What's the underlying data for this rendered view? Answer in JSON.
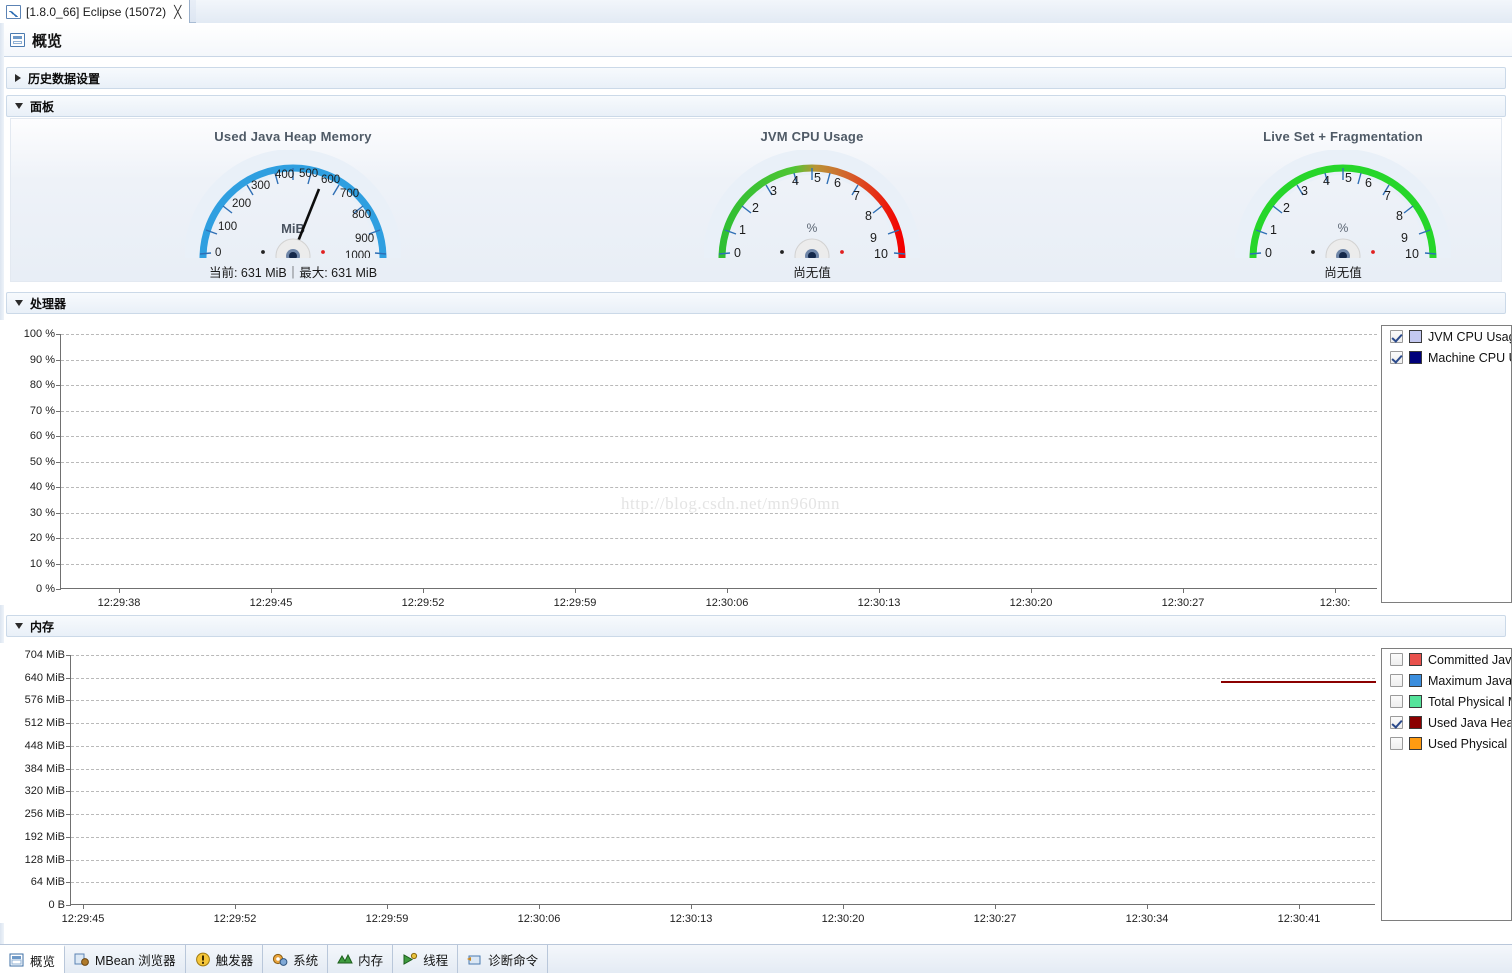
{
  "window": {
    "tab_label": "[1.8.0_66] Eclipse (15072)",
    "tab_icon": "chart-line-icon",
    "close_icon": "╳"
  },
  "page": {
    "title": "概览",
    "icon": "overview-icon"
  },
  "sections": [
    {
      "key": "history",
      "label": "历史数据设置",
      "expanded": false
    },
    {
      "key": "dashboard",
      "label": "面板",
      "expanded": true
    },
    {
      "key": "processor",
      "label": "处理器",
      "expanded": true
    },
    {
      "key": "memory",
      "label": "内存",
      "expanded": true
    }
  ],
  "dashboard": {
    "gauges": [
      {
        "title": "Used Java Heap Memory",
        "unit": "MiB",
        "ticks": [
          "0",
          "100",
          "200",
          "300",
          "400",
          "500",
          "600",
          "700",
          "800",
          "900",
          "1000"
        ],
        "min": 0,
        "max": 1000,
        "value": 631,
        "arc_color": "#2f9fe0",
        "footer": "当前: 631 MiB｜最大: 631 MiB",
        "footer_current_label": "当前",
        "footer_current_value": "631 MiB",
        "footer_max_label": "最大",
        "footer_max_value": "631 MiB"
      },
      {
        "title": "JVM CPU Usage",
        "unit": "%",
        "ticks": [
          "0",
          "1",
          "2",
          "3",
          "4",
          "5",
          "6",
          "7",
          "8",
          "9",
          "10"
        ],
        "min": 0,
        "max": 10,
        "value": null,
        "arc_color": "green-to-red",
        "footer": "尚无值"
      },
      {
        "title": "Live Set + Fragmentation",
        "unit": "%",
        "ticks": [
          "0",
          "1",
          "2",
          "3",
          "4",
          "5",
          "6",
          "7",
          "8",
          "9",
          "10"
        ],
        "min": 0,
        "max": 10,
        "value": null,
        "arc_color": "#26d62a",
        "footer": "尚无值"
      }
    ]
  },
  "chart_data": [
    {
      "id": "processor",
      "type": "line",
      "title": "处理器",
      "xlabel": "",
      "ylabel": "",
      "ylim": [
        0,
        100
      ],
      "yticks": [
        "0 %",
        "10 %",
        "20 %",
        "30 %",
        "40 %",
        "50 %",
        "60 %",
        "70 %",
        "80 %",
        "90 %",
        "100 %"
      ],
      "xticks": [
        "12:29:38",
        "12:29:45",
        "12:29:52",
        "12:29:59",
        "12:30:06",
        "12:30:13",
        "12:30:20",
        "12:30:27",
        "12:30:"
      ],
      "grid": true,
      "legend_position": "right",
      "watermark": "http://blog.csdn.net/mn960mn",
      "series": [
        {
          "name": "JVM CPU Usage",
          "color": "#c3c8f0",
          "checked": true,
          "values": []
        },
        {
          "name": "Machine CPU U",
          "color": "#00007a",
          "checked": true,
          "values": []
        }
      ]
    },
    {
      "id": "memory",
      "type": "line",
      "title": "内存",
      "xlabel": "",
      "ylabel": "",
      "ylim": [
        0,
        704
      ],
      "yticks": [
        "0 B",
        "64 MiB",
        "128 MiB",
        "192 MiB",
        "256 MiB",
        "320 MiB",
        "384 MiB",
        "448 MiB",
        "512 MiB",
        "576 MiB",
        "640 MiB",
        "704 MiB"
      ],
      "xticks": [
        "12:29:45",
        "12:29:52",
        "12:29:59",
        "12:30:06",
        "12:30:13",
        "12:30:20",
        "12:30:27",
        "12:30:34",
        "12:30:41"
      ],
      "grid": true,
      "legend_position": "right",
      "series": [
        {
          "name": "Committed Java",
          "color": "#e8514d",
          "checked": false,
          "values": []
        },
        {
          "name": "Maximum Java ",
          "color": "#3b8ede",
          "checked": false,
          "values": []
        },
        {
          "name": "Total Physical M",
          "color": "#55e39b",
          "checked": false,
          "values": []
        },
        {
          "name": "Used Java Heap",
          "color": "#8b0000",
          "checked": true,
          "values": [
            631,
            631,
            631,
            631
          ]
        },
        {
          "name": "Used Physical M",
          "color": "#ff9b11",
          "checked": false,
          "values": []
        }
      ]
    }
  ],
  "bottom_tabs": [
    {
      "label": "概览",
      "icon": "overview-icon",
      "active": true
    },
    {
      "label": "MBean 浏览器",
      "icon": "mbean-icon",
      "active": false
    },
    {
      "label": "触发器",
      "icon": "trigger-icon",
      "active": false
    },
    {
      "label": "系统",
      "icon": "system-gear-icon",
      "active": false
    },
    {
      "label": "内存",
      "icon": "memory-icon",
      "active": false
    },
    {
      "label": "线程",
      "icon": "thread-icon",
      "active": false
    },
    {
      "label": "诊断命令",
      "icon": "diagnostic-icon",
      "active": false
    }
  ]
}
